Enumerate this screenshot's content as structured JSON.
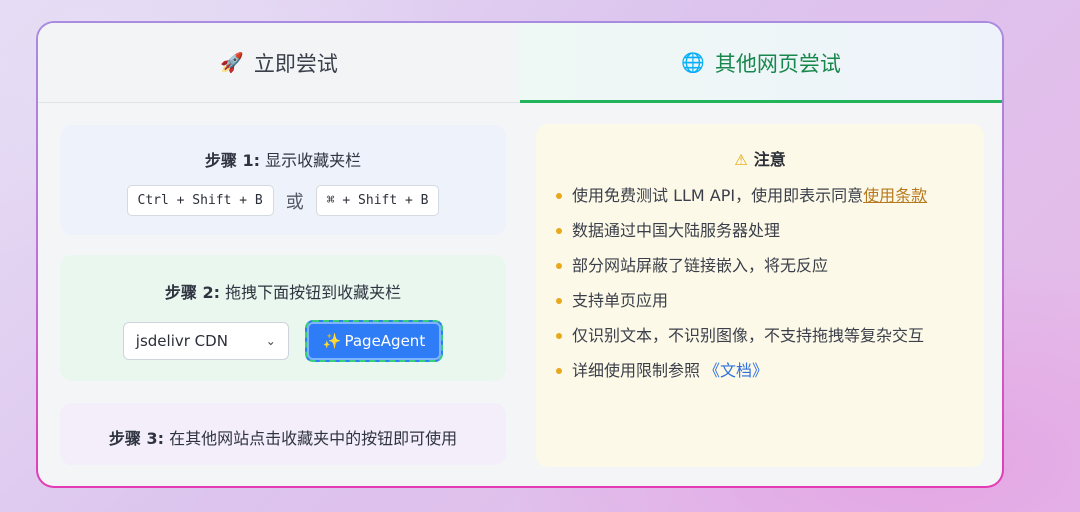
{
  "tabs": [
    {
      "icon": "🚀",
      "label": "立即尝试"
    },
    {
      "icon": "🌐",
      "label": "其他网页尝试"
    }
  ],
  "step1": {
    "prefix": "步骤 1:",
    "text": "显示收藏夹栏",
    "shortcut_windows": "Ctrl + Shift + B",
    "or": "或",
    "shortcut_mac": "⌘ + Shift + B"
  },
  "step2": {
    "prefix": "步骤 2:",
    "text": "拖拽下面按钮到收藏夹栏",
    "select_value": "jsdelivr CDN",
    "button_icon": "✨",
    "button_label": "PageAgent"
  },
  "step3": {
    "prefix": "步骤 3:",
    "text": "在其他网站点击收藏夹中的按钮即可使用"
  },
  "notice": {
    "icon": "⚠",
    "title": "注意",
    "items": [
      "使用免费测试 LLM API，使用即表示同意",
      "数据通过中国大陆服务器处理",
      "部分网站屏蔽了链接嵌入，将无反应",
      "支持单页应用",
      "仅识别文本，不识别图像，不支持拖拽等复杂交互",
      "详细使用限制参照"
    ],
    "terms_link": "使用条款",
    "doc_link": "《文档》"
  },
  "colors": {
    "active_tab_text": "#18874c",
    "active_tab_underline": "#22b45a",
    "button_bg": "#2f7df6",
    "bullet": "#e7a81a",
    "doc_link": "#2f6fdd"
  }
}
